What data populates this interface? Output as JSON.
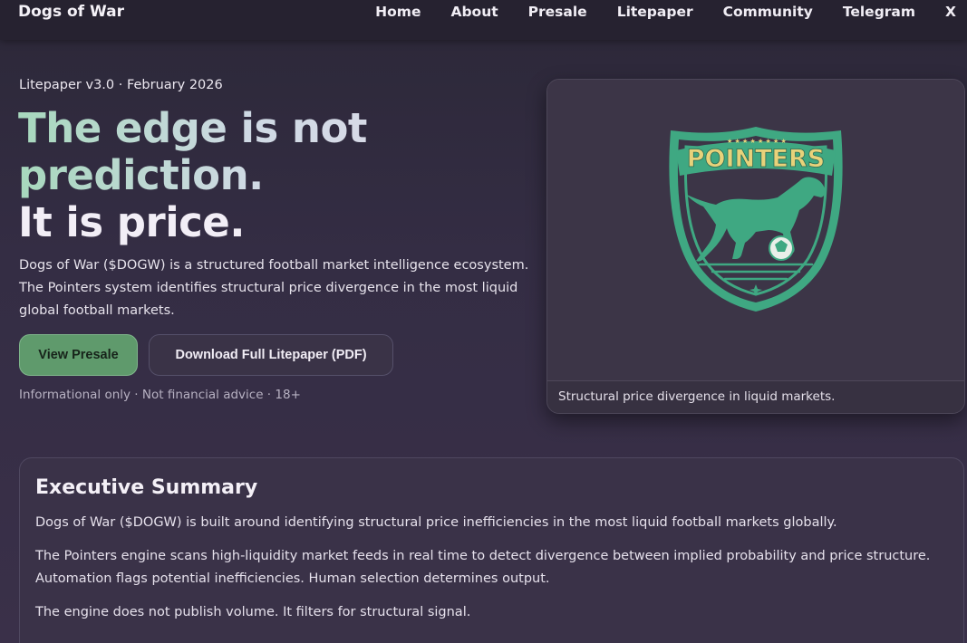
{
  "nav": {
    "brand": "Dogs of War",
    "links": [
      "Home",
      "About",
      "Presale",
      "Litepaper",
      "Community",
      "Telegram",
      "X"
    ]
  },
  "hero": {
    "meta": "Litepaper v3.0 · February 2026",
    "headline": [
      "The edge is not",
      "prediction.",
      "It is price."
    ],
    "lead_lines": [
      "Dogs of War ($DOGW) is a structured football market intelligence ecosystem.",
      "The Pointers system identifies structural price divergence in the most liquid",
      "global football markets."
    ],
    "primary_button": "View Presale",
    "secondary_button": "Download Full Litepaper (PDF)",
    "disclaimer": "Informational only · Not financial advice · 18+"
  },
  "card": {
    "logo_text": "POINTERS",
    "caption": "Structural price divergence in liquid markets."
  },
  "summary": {
    "title": "Executive Summary",
    "p1": "Dogs of War ($DOGW) is built around identifying structural price inefficiencies in the most liquid football markets globally.",
    "p2_lines": [
      "The Pointers engine scans high-liquidity market feeds in real time to detect divergence between implied probability and price structure.",
      "Automation flags potential inefficiencies. Human selection determines output."
    ],
    "p3": "The engine does not publish volume. It filters for structural signal."
  },
  "colors": {
    "accent_green": "#5f9a6c",
    "logo_green": "#3fa882",
    "logo_gold": "#e8d27a"
  }
}
